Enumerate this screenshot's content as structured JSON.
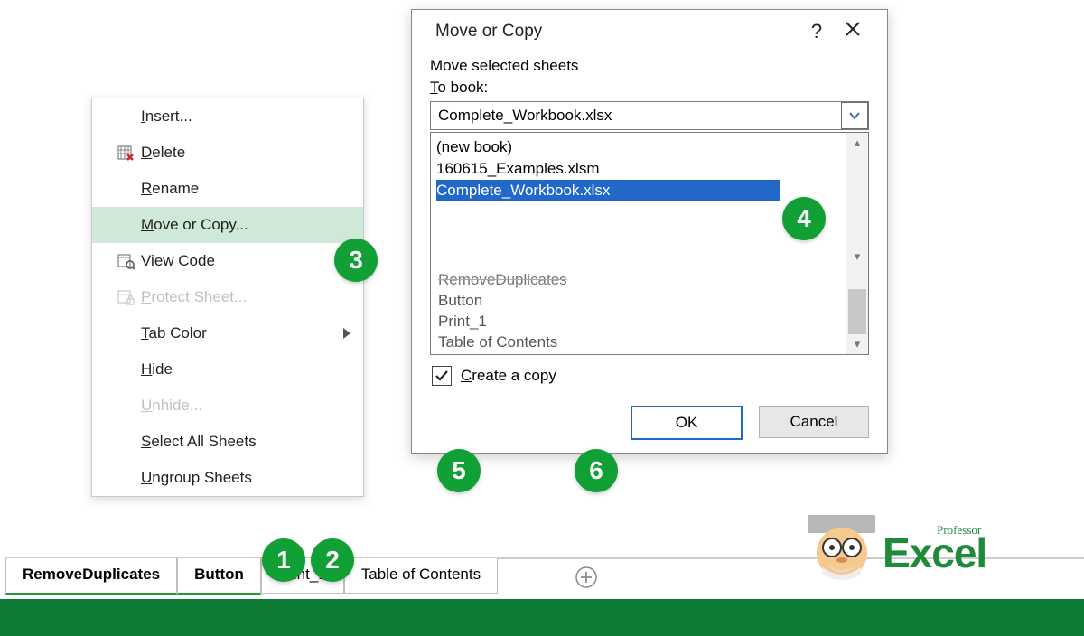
{
  "context_menu": {
    "insert": "Insert...",
    "delete": "Delete",
    "rename": "Rename",
    "move_or_copy": "Move or Copy...",
    "view_code": "View Code",
    "protect_sheet": "Protect Sheet...",
    "tab_color": "Tab Color",
    "hide": "Hide",
    "unhide": "Unhide...",
    "select_all": "Select All Sheets",
    "ungroup": "Ungroup Sheets"
  },
  "dialog": {
    "title": "Move or Copy",
    "help": "?",
    "close": "✕",
    "move_selected": "Move selected sheets",
    "to_book": "To book:",
    "combo_value": "Complete_Workbook.xlsx",
    "book_options": [
      "(new book)",
      "160615_Examples.xlsm",
      "Complete_Workbook.xlsx"
    ],
    "sheet_list": [
      "RemoveDuplicates",
      "Button",
      "Print_1",
      "Table of Contents"
    ],
    "create_copy": "Create a copy",
    "ok": "OK",
    "cancel": "Cancel"
  },
  "tabs": [
    "RemoveDuplicates",
    "Button",
    "Print_1",
    "Table of Contents"
  ],
  "badges": {
    "b1": "1",
    "b2": "2",
    "b3": "3",
    "b4": "4",
    "b5": "5",
    "b6": "6"
  },
  "logo": {
    "professor": "Professor",
    "excel": "Excel"
  }
}
